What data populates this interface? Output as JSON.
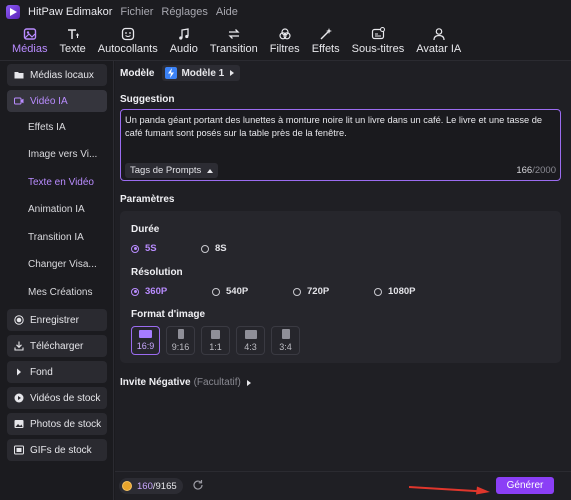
{
  "app": {
    "name": "HitPaw Edimakor",
    "menus": [
      "Fichier",
      "Réglages",
      "Aide"
    ]
  },
  "tabs": [
    {
      "label": "Médias",
      "icon": "media-icon",
      "active": true
    },
    {
      "label": "Texte",
      "icon": "text-icon"
    },
    {
      "label": "Autocollants",
      "icon": "sticker-icon"
    },
    {
      "label": "Audio",
      "icon": "music-icon"
    },
    {
      "label": "Transition",
      "icon": "transition-icon"
    },
    {
      "label": "Filtres",
      "icon": "filter-icon"
    },
    {
      "label": "Effets",
      "icon": "effects-icon"
    },
    {
      "label": "Sous-titres",
      "icon": "subtitles-icon"
    },
    {
      "label": "Avatar IA",
      "icon": "avatar-icon"
    }
  ],
  "sidebar": {
    "local": "Médias locaux",
    "ai_video": "Vidéo IA",
    "sub": [
      "Effets IA",
      "Image vers Vi...",
      "Texte en Vidéo",
      "Animation IA",
      "Transition IA",
      "Changer Visa...",
      "Mes Créations"
    ],
    "selected_sub": "Texte en Vidéo",
    "record": "Enregistrer",
    "download": "Télécharger",
    "background": "Fond",
    "stock_videos": "Vidéos de stock",
    "stock_photos": "Photos de stock",
    "stock_gifs": "GIFs de stock"
  },
  "main": {
    "model_label": "Modèle",
    "model_value": "Modèle 1",
    "suggestion_label": "Suggestion",
    "prompt": "Un panda géant portant des lunettes à monture noire lit un livre dans un café. Le livre et une tasse de café fumant sont posés sur la table près de la fenêtre.",
    "tags_button": "Tags de Prompts",
    "char_count": "166",
    "char_max": "/2000",
    "params_label": "Paramètres",
    "duration_label": "Durée",
    "durations": [
      "5S",
      "8S"
    ],
    "duration_selected": "5S",
    "resolution_label": "Résolution",
    "resolutions": [
      "360P",
      "540P",
      "720P",
      "1080P"
    ],
    "resolution_selected": "360P",
    "format_label": "Format d'image",
    "ratios": [
      "16:9",
      "9:16",
      "1:1",
      "4:3",
      "3:4"
    ],
    "ratio_selected": "16:9",
    "negative_label": "Invite Négative",
    "negative_optional": "(Facultatif)"
  },
  "bottom": {
    "credits_used": "160",
    "credits_total": "/9165",
    "generate": "Générer"
  },
  "colors": {
    "accent": "#b98cff",
    "button": "#8b3ff6",
    "arrow": "#e0362c"
  }
}
